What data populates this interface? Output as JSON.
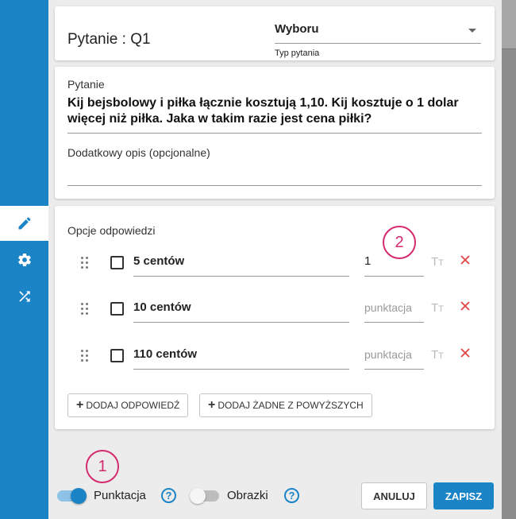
{
  "question_header": {
    "title": "Pytanie : Q1",
    "type_value": "Wyboru",
    "type_label": "Typ pytania"
  },
  "question_card": {
    "question_label": "Pytanie",
    "question_text": "Kij bejsbolowy i piłka łącznie kosztują 1,10. Kij kosztuje o 1 dolar więcej niż piłka. Jaka w takim razie jest cena piłki?",
    "description_label": "Dodatkowy opis (opcjonalne)"
  },
  "answers": {
    "section_label": "Opcje odpowiedzi",
    "options": [
      {
        "text": "5 centów",
        "score": "1"
      },
      {
        "text": "10 centów",
        "score": "punktacja"
      },
      {
        "text": "110 centów",
        "score": "punktacja"
      }
    ],
    "text_format_icon": "T",
    "text_format_icon_small": "T",
    "add_answer_label": "DODAJ ODPOWIEDŹ",
    "add_none_label": "DODAJ ŻADNE Z POWYŻSZYCH"
  },
  "footer": {
    "scoring_label": "Punktacja",
    "scoring_on": true,
    "images_label": "Obrazki",
    "images_on": false,
    "help_symbol": "?",
    "cancel_label": "ANULUJ",
    "save_label": "ZAPISZ"
  },
  "markers": {
    "marker1": "1",
    "marker2": "2"
  },
  "sidebar": {
    "icons": [
      "pencil-icon",
      "gear-icon",
      "shuffle-icon"
    ]
  },
  "colors": {
    "brand": "#1b84c7",
    "delete": "#e04646",
    "marker": "#d42a6e"
  }
}
